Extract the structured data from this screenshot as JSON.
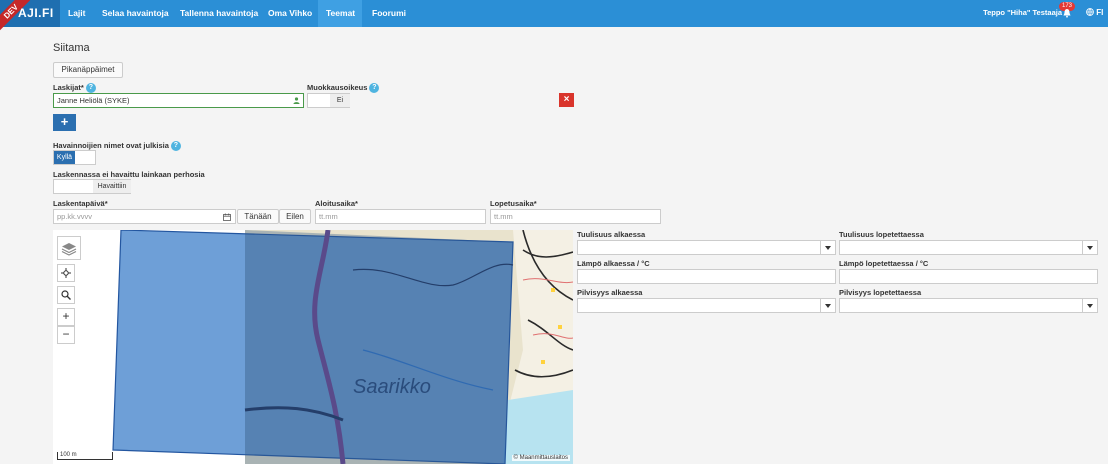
{
  "nav": {
    "dev_label": "DEV",
    "brand": "AJI.FI",
    "items": [
      "Lajit",
      "Selaa havaintoja",
      "Tallenna havaintoja",
      "Oma Vihko",
      "Teemat",
      "Foorumi"
    ],
    "active": "Teemat",
    "user": "Teppo \"Hiha\" Testaaja",
    "notification_count": "173",
    "language": "FI"
  },
  "page": {
    "title": "Siitama",
    "shortcuts_button": "Pikanäppäimet"
  },
  "counters": {
    "label": "Laskijat*",
    "value": "Janne Heliölä (SYKE)",
    "add_button": "+",
    "remove_button": "×"
  },
  "edit_rights": {
    "label": "Muokkausoikeus",
    "value": "Ei"
  },
  "public_names": {
    "label": "Havainnoijien nimet ovat julkisia",
    "value": "Kyllä"
  },
  "no_butterflies": {
    "label": "Laskennassa ei havaittu lainkaan perhosia",
    "value": "Havaittiin"
  },
  "date": {
    "label": "Laskentapäivä*",
    "placeholder": "pp.kk.vvvv",
    "today": "Tänään",
    "yesterday": "Eilen"
  },
  "start_time": {
    "label": "Aloitusaika*",
    "placeholder": "tt.mm"
  },
  "end_time": {
    "label": "Lopetusaika*",
    "placeholder": "tt.mm"
  },
  "weather": {
    "wind_start": "Tuulisuus alkaessa",
    "wind_end": "Tuulisuus lopetettaessa",
    "temp_start": "Lämpö alkaessa / °C",
    "temp_end": "Lämpö lopetettaessa / °C",
    "cloud_start": "Pilvisyys alkaessa",
    "cloud_end": "Pilvisyys lopetettaessa"
  },
  "map": {
    "place_name": "Saarikko",
    "scale": "100 m",
    "attribution": "© Maanmittauslaitos",
    "zoom_in": "+",
    "zoom_out": "−",
    "polygon_color": "#3d7fc9"
  }
}
